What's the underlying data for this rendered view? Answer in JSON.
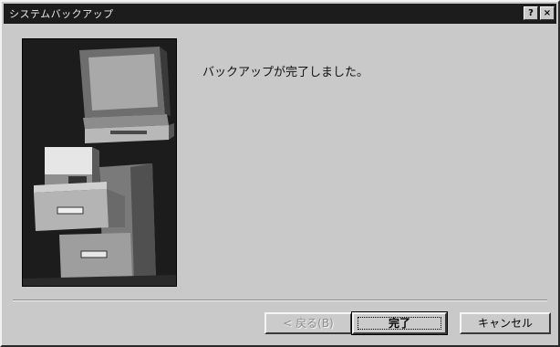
{
  "window": {
    "title": "システムバックアップ",
    "title_buttons": {
      "help": "?",
      "close": "×"
    }
  },
  "main": {
    "message": "バックアップが完了しました。"
  },
  "buttons": {
    "back": "< 戻る(B)",
    "finish": "完了",
    "cancel": "キャンセル"
  },
  "icons": {
    "illustration": "computer-and-filing-cabinet-illustration"
  }
}
